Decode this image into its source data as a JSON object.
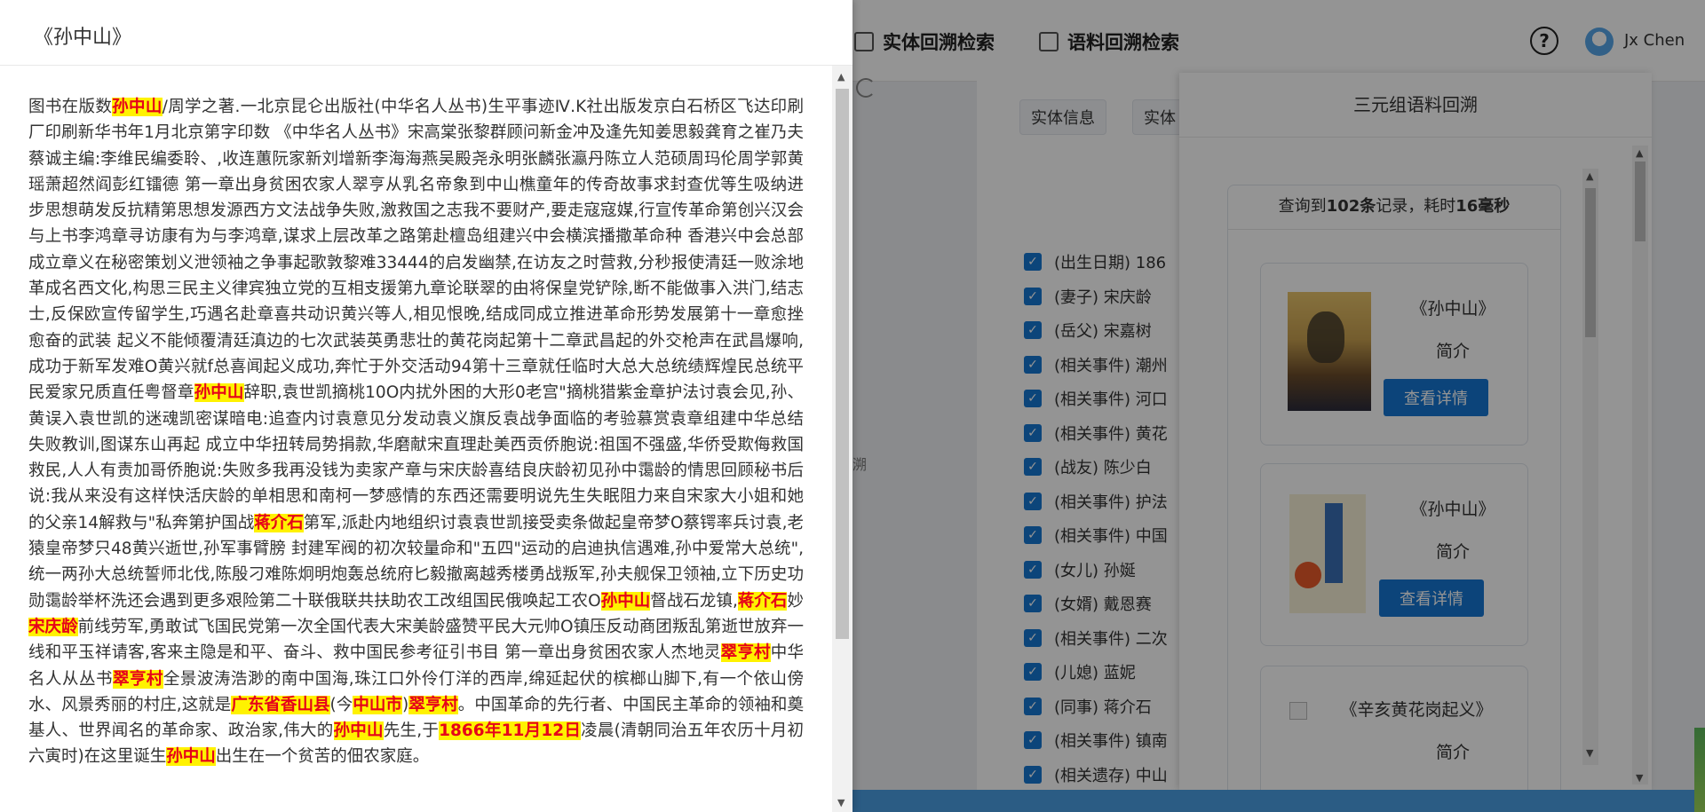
{
  "header": {
    "tabs": [
      {
        "label": "实体回溯检索"
      },
      {
        "label": "语料回溯检索"
      }
    ],
    "help_icon": "?",
    "username": "Jx Chen"
  },
  "side_text": "溯",
  "entity_panel": {
    "tabs": [
      "实体信息",
      "实体"
    ],
    "rows": [
      "(出生日期) 186",
      "(妻子) 宋庆龄",
      "(岳父) 宋嘉树",
      "(相关事件) 潮州",
      "(相关事件) 河口",
      "(相关事件) 黄花",
      "(战友) 陈少白",
      "(相关事件) 护法",
      "(相关事件) 中国",
      "(女儿) 孙娫",
      "(女婿) 戴恩赛",
      "(相关事件) 二次",
      "(儿媳) 蓝妮",
      "(同事) 蒋介石",
      "(相关事件) 镇南",
      "(相关遗存) 中山"
    ]
  },
  "drawer": {
    "title": "三元组语料回溯",
    "summary_prefix": "查询到",
    "summary_count": "102条",
    "summary_mid": "记录，耗时",
    "summary_time": "16毫秒",
    "books": [
      {
        "title": "《孙中山》",
        "intro": "简介",
        "button": "查看详情"
      },
      {
        "title": "《孙中山》",
        "intro": "简介",
        "button": "查看详情"
      },
      {
        "title": "《辛亥黄花岗起义》",
        "intro": "简介"
      }
    ]
  },
  "document": {
    "title": "《孙中山》",
    "segments": [
      {
        "t": "图书在版数"
      },
      {
        "h": "孙中山"
      },
      {
        "t": "/周学之著.一北京昆仑出版社(中华名人丛书)生平事迹Ⅳ.K社出版发京白石桥区飞达印刷厂印刷新华书年1月北京第字印数 《中华名人丛书》宋高棠张黎群顾问新金冲及逢先知姜思毅龚育之崔乃夫蔡诚主编:李维民编委聆、,收连蕙阮家新刘增新李海海燕吴殿尧永明张麟张瀛丹陈立人范硕周玛伦周学郭黄瑶萧超然阎彭红镭德 第一章出身贫困农家人翠亨从乳名帝象到中山樵童年的传奇故事求封查优等生吸纳进步思想萌发反抗精第思想发源西方文法战争失败,激救国之志我不要财产,要走寇寇媒,行宣传革命第创兴汉会与上书李鸿章寻访康有为与李鸿章,谋求上层改革之路第赴檀岛组建兴中会横滨播撒革命种 香港兴中会总部成立章义在秘密策划义泄领袖之争事起歌敦黎难33444的启发幽禁,在访友之时营救,分秒报使清廷一败涂地革成名西文化,构思三民主义律宾独立党的互相支援第九章论联翠的由将保皇党铲除,断不能做事入洪门,结志士,反保欧宣传留学生,巧遇名赴章喜共动识黄兴等人,相见恨晚,结成同成立推进革命形势发展第十一章愈挫愈奋的武装 起义不能倾覆清廷滇边的七次武装英勇悲壮的黄花岗起第十二章武昌起的外交枪声在武昌爆响,成功于新军发难O黄兴就f总喜闻起义成功,奔忙于外交活动94第十三章就任临时大总大总统绩辉煌民总统平民爱家兄质直任粤督章"
      },
      {
        "h": "孙中山"
      },
      {
        "t": "辞职,袁世凯摘桃10O内扰外困的大形0老宫\"摘桃猎紫金章护法讨袁会见,孙、黄误入袁世凯的迷魂凯密谋暗电:追查内讨袁意见分发动袁义旗反袁战争面临的考验慕赏袁章组建中华总结失败教训,图谋东山再起 成立中华扭转局势捐款,华磨献宋直理赴美西贡侨胞说:祖国不强盛,华侨受欺侮救国救民,人人有责加哥侨胞说:失败多我再没钱为卖家产章与宋庆龄喜结良庆龄初见孙中霭龄的情思回顾秘书后说:我从来没有这样快活庆龄的单相思和南柯一梦感情的东西还需要明说先生失眠阻力来自宋家大小姐和她的父亲14解救与\"私奔第护国战"
      },
      {
        "h": "蒋介石"
      },
      {
        "t": "第军,派赴内地组织讨袁袁世凯接受卖条做起皇帝梦O蔡锷率兵讨袁,老猿皇帝梦只48黄兴逝世,孙军事臂膀 封建军阀的初次较量命和\"五四\"运动的启迪执信遇难,孙中爱常大总统\",统一两孙大总统誓师北伐,陈殷刁难陈炯明炮轰总统府匕毅撤离越秀楼勇战叛军,孙夫舰保卫领袖,立下历史功勋霭龄举杯洗还会遇到更多艰险第二十联俄联共扶助农工改组国民俄唤起工农O"
      },
      {
        "h": "孙中山"
      },
      {
        "t": "督战石龙镇,"
      },
      {
        "h": "蒋介石"
      },
      {
        "t": "妙"
      },
      {
        "h": "宋庆龄"
      },
      {
        "t": "前线劳军,勇敢试飞国民党第一次全国代表大宋美龄盛赞平民大元帅O镇压反动商团叛乱第逝世放弃一线和平玉祥请客,客来主隐是和平、奋斗、救中国民参考征引书目 第一章出身贫困农家人杰地灵"
      },
      {
        "h": "翠亨村"
      },
      {
        "t": "中华名人从丛书"
      },
      {
        "h": "翠亨村"
      },
      {
        "t": "全景波涛浩渺的南中国海,珠江口外伶仃洋的西岸,绵延起伏的槟榔山脚下,有一个依山傍水、风景秀丽的村庄,这就是"
      },
      {
        "h": "广东省香山县"
      },
      {
        "t": "(今"
      },
      {
        "h": "中山市"
      },
      {
        "t": ")"
      },
      {
        "h": "翠亨村"
      },
      {
        "t": "。中国革命的先行者、中国民主革命的领袖和奠基人、世界闻名的革命家、政治家,伟大的"
      },
      {
        "h": "孙中山"
      },
      {
        "t": "先生,于"
      },
      {
        "h": "1866年11月12日"
      },
      {
        "t": "凌晨(清朝同治五年农历十月初六寅时)在这里诞生"
      },
      {
        "h": "孙中山"
      },
      {
        "t": "出生在一个贫苦的佃农家庭。"
      }
    ]
  },
  "colors": {
    "accent": "#1676d2",
    "highlight_bg": "#fff200",
    "highlight_text": "#e6001a"
  }
}
